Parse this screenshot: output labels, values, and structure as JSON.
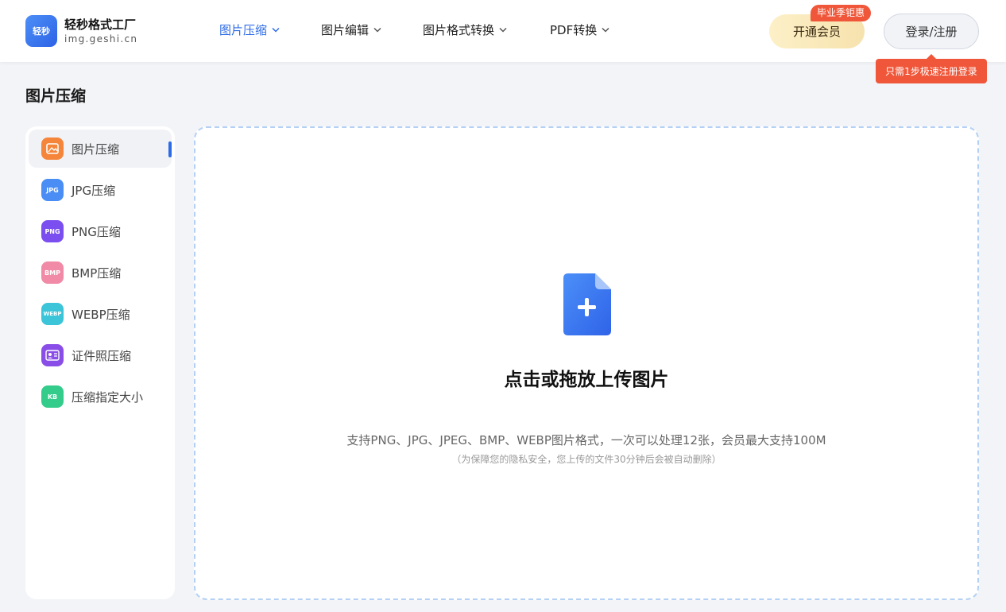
{
  "header": {
    "logo_mark": "轻秒",
    "logo_name": "轻秒格式工厂",
    "logo_domain": "img.geshi.cn",
    "nav": [
      {
        "label": "图片压缩",
        "active": true
      },
      {
        "label": "图片编辑",
        "active": false
      },
      {
        "label": "图片格式转换",
        "active": false
      },
      {
        "label": "PDF转换",
        "active": false
      }
    ],
    "vip_label": "开通会员",
    "vip_badge": "毕业季钜惠",
    "login_label": "登录/注册",
    "login_tooltip": "只需1步极速注册登录"
  },
  "page_title": "图片压缩",
  "sidebar": {
    "items": [
      {
        "label": "图片压缩",
        "icon": "image-compress-icon",
        "badge": "",
        "color": "#f5853a",
        "active": true
      },
      {
        "label": "JPG压缩",
        "icon": "jpg-compress-icon",
        "badge": "JPG",
        "color": "#4a8ef5",
        "active": false
      },
      {
        "label": "PNG压缩",
        "icon": "png-compress-icon",
        "badge": "PNG",
        "color": "#7b4ef0",
        "active": false
      },
      {
        "label": "BMP压缩",
        "icon": "bmp-compress-icon",
        "badge": "BMP",
        "color": "#f08aa6",
        "active": false
      },
      {
        "label": "WEBP压缩",
        "icon": "webp-compress-icon",
        "badge": "WEBP",
        "color": "#3cc4d8",
        "active": false
      },
      {
        "label": "证件照压缩",
        "icon": "id-photo-compress-icon",
        "badge": "",
        "color": "#8a4ee8",
        "active": false
      },
      {
        "label": "压缩指定大小",
        "icon": "size-compress-icon",
        "badge": "KB",
        "color": "#33cc8a",
        "active": false
      }
    ]
  },
  "upload": {
    "title": "点击或拖放上传图片",
    "description": "支持PNG、JPG、JPEG、BMP、WEBP图片格式，一次可以处理12张，会员最大支持100M",
    "note": "（为保障您的隐私安全，您上传的文件30分钟后会被自动删除）"
  },
  "colors": {
    "accent": "#2d6be6",
    "badge": "#f0573a",
    "dashed_border": "#b4d0f4",
    "background": "#f2f4f8"
  }
}
